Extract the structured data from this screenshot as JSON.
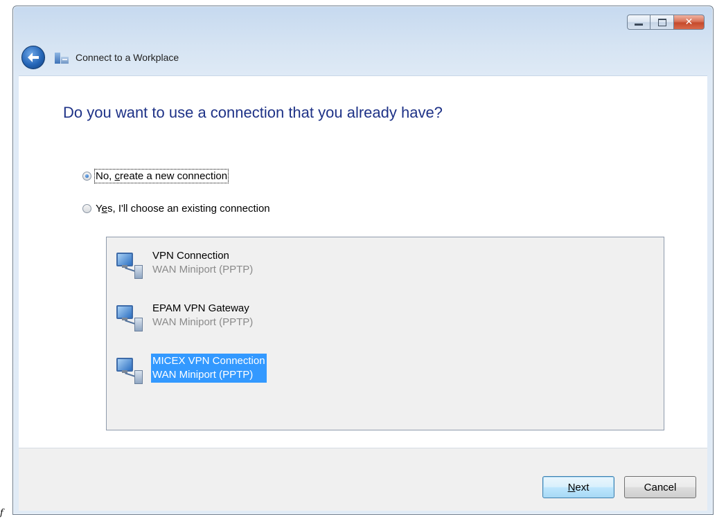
{
  "window": {
    "title": "Connect to a Workplace",
    "controls": {
      "minimize": "minimize",
      "maximize": "maximize",
      "close": "close"
    }
  },
  "content": {
    "question": "Do you want to use a connection that you already have?",
    "options": [
      {
        "label": "No, create a new connection",
        "selected": true
      },
      {
        "label": "Yes, I'll choose an existing connection",
        "selected": false
      }
    ],
    "connections": [
      {
        "name": "VPN Connection",
        "device": "WAN Miniport (PPTP)",
        "selected": false,
        "icon": "network-connection-icon"
      },
      {
        "name": "EPAM VPN Gateway",
        "device": "WAN Miniport (PPTP)",
        "selected": false,
        "icon": "network-connection-icon"
      },
      {
        "name": "MICEX VPN Connection",
        "device": "WAN Miniport (PPTP)",
        "selected": true,
        "icon": "network-connection-icon"
      }
    ]
  },
  "footer": {
    "next_label": "Next",
    "cancel_label": "Cancel"
  },
  "stray_text": "f",
  "colors": {
    "accent_text": "#1e3287",
    "selection": "#3399ff"
  }
}
